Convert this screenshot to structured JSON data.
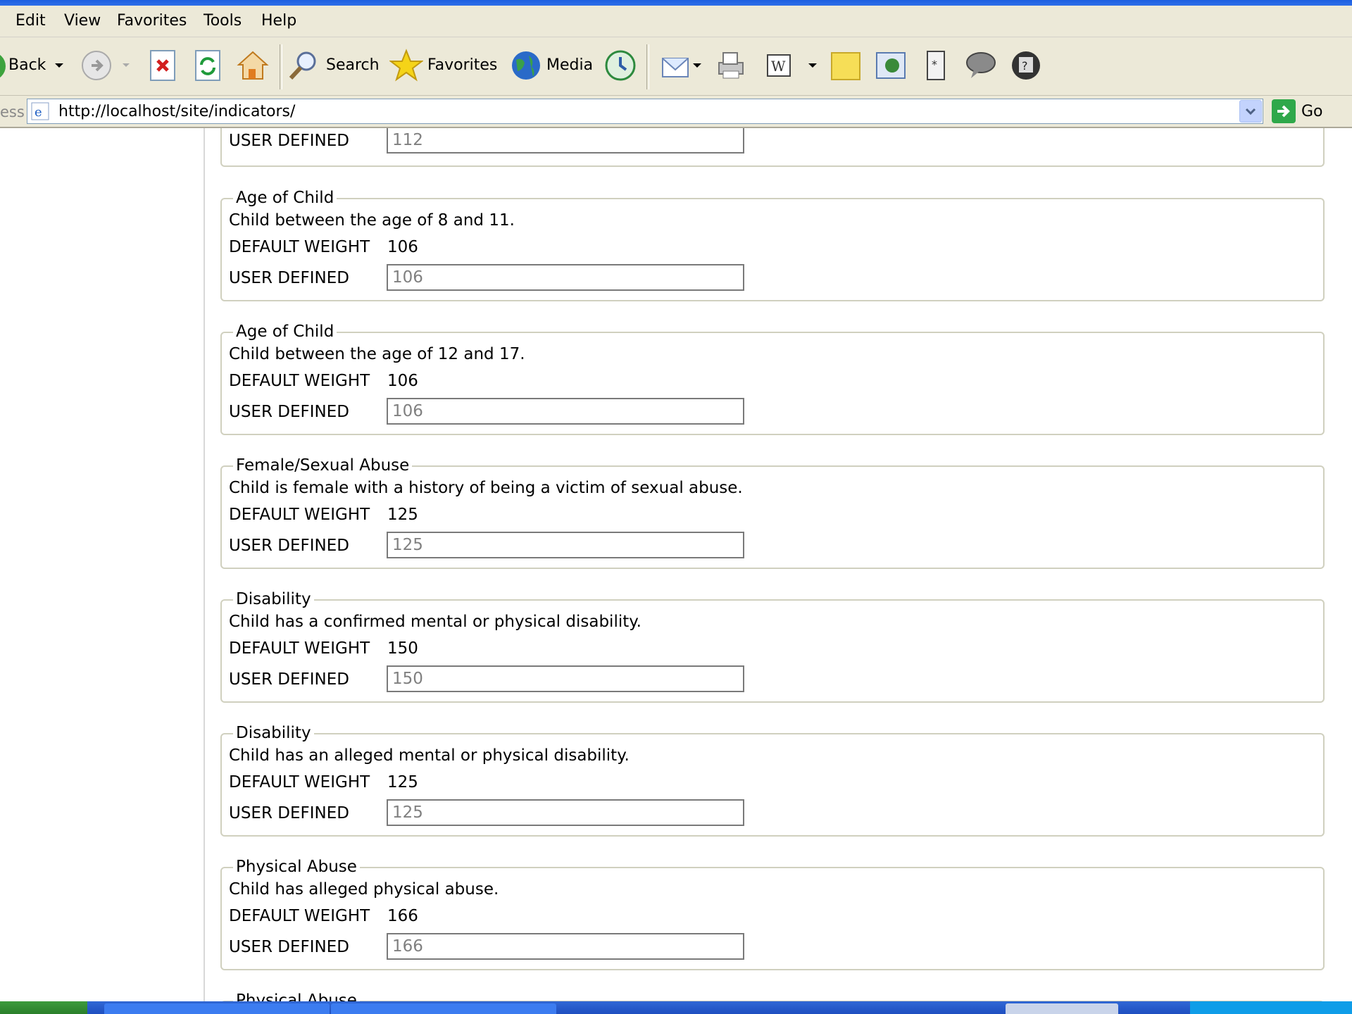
{
  "menu": [
    "Edit",
    "View",
    "Favorites",
    "Tools",
    "Help"
  ],
  "toolbar": {
    "back_label": "Back",
    "search_label": "Search",
    "favorites_label": "Favorites",
    "media_label": "Media"
  },
  "address": {
    "label": "ess",
    "url": "http://localhost/site/indicators/",
    "go_label": "Go"
  },
  "indicators": {
    "top": {
      "user_defined_label": "USER DEFINED",
      "user_value": "112"
    },
    "items": [
      {
        "legend": "Age of Child",
        "description": "Child between the age of 8 and 11.",
        "default_label": "DEFAULT WEIGHT",
        "default_weight": "106",
        "user_defined_label": "USER DEFINED",
        "user_value": "106"
      },
      {
        "legend": "Age of Child",
        "description": "Child between the age of 12 and 17.",
        "default_label": "DEFAULT WEIGHT",
        "default_weight": "106",
        "user_defined_label": "USER DEFINED",
        "user_value": "106"
      },
      {
        "legend": "Female/Sexual Abuse",
        "description": "Child is female with a history of being a victim of sexual abuse.",
        "default_label": "DEFAULT WEIGHT",
        "default_weight": "125",
        "user_defined_label": "USER DEFINED",
        "user_value": "125"
      },
      {
        "legend": "Disability",
        "description": "Child has a confirmed mental or physical disability.",
        "default_label": "DEFAULT WEIGHT",
        "default_weight": "150",
        "user_defined_label": "USER DEFINED",
        "user_value": "150"
      },
      {
        "legend": "Disability",
        "description": "Child has an alleged mental or physical disability.",
        "default_label": "DEFAULT WEIGHT",
        "default_weight": "125",
        "user_defined_label": "USER DEFINED",
        "user_value": "125"
      },
      {
        "legend": "Physical Abuse",
        "description": "Child has alleged physical abuse.",
        "default_label": "DEFAULT WEIGHT",
        "default_weight": "166",
        "user_defined_label": "USER DEFINED",
        "user_value": "166"
      }
    ],
    "partial_legend": "Physical Abuse"
  }
}
